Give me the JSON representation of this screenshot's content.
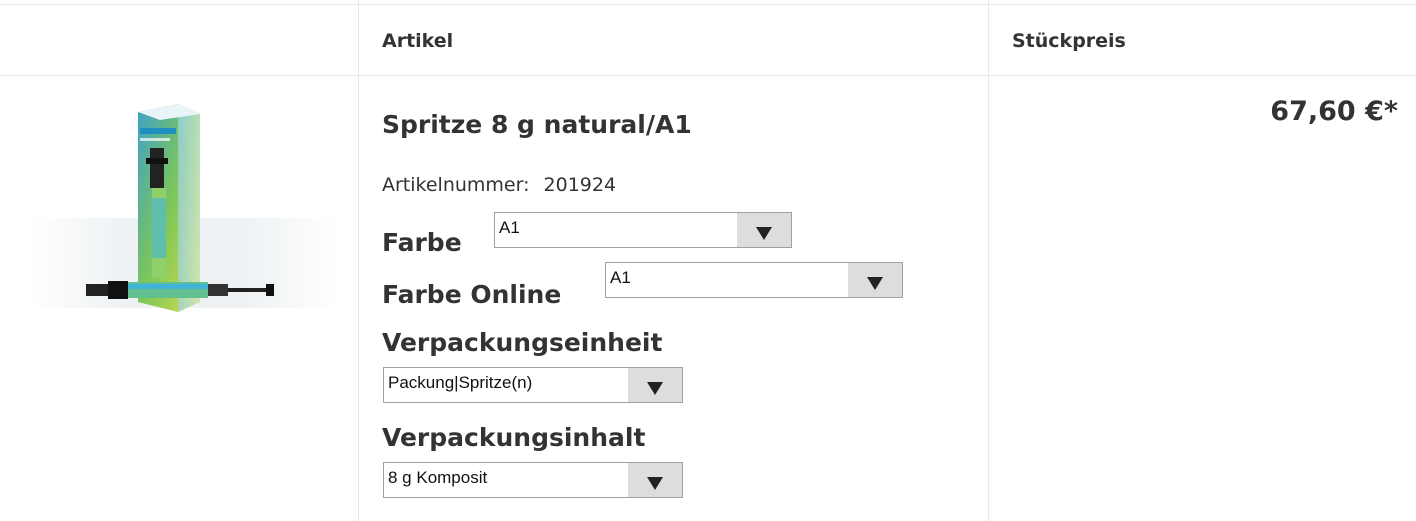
{
  "table": {
    "headers": {
      "article": "Artikel",
      "unit_price": "Stückpreis"
    }
  },
  "product": {
    "title": "Spritze 8 g natural/A1",
    "article_number_label": "Artikelnummer:",
    "article_number": "201924",
    "price": "67,60 €*",
    "options": {
      "farbe": {
        "label": "Farbe",
        "value": "A1"
      },
      "farbe_online": {
        "label": "Farbe Online",
        "value": "A1"
      },
      "verpackungseinheit": {
        "label": "Verpackungseinheit",
        "value": "Packung|Spritze(n)"
      },
      "verpackungsinhalt": {
        "label": "Verpackungsinhalt",
        "value": "8 g Komposit"
      }
    }
  },
  "icons": {
    "dropdown": "triangle-down-icon"
  }
}
